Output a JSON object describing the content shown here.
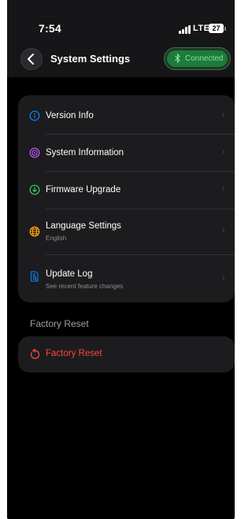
{
  "status_bar": {
    "time": "7:54",
    "network": "LTE",
    "battery": "27"
  },
  "header": {
    "title": "System Settings",
    "connection_status": "Connected",
    "connection_icon": "bluetooth-icon"
  },
  "settings": {
    "items": [
      {
        "label": "Version Info",
        "subtitle": "",
        "icon": "info-icon",
        "icon_color": "#0a84ff"
      },
      {
        "label": "System Information",
        "subtitle": "",
        "icon": "target-icon",
        "icon_color": "#bf5af2"
      },
      {
        "label": "Firmware Upgrade",
        "subtitle": "",
        "icon": "download-icon",
        "icon_color": "#30d158"
      },
      {
        "label": "Language Settings",
        "subtitle": "English",
        "icon": "globe-icon",
        "icon_color": "#ff9f0a"
      },
      {
        "label": "Update Log",
        "subtitle": "See recent feature changes",
        "icon": "document-search-icon",
        "icon_color": "#0a84ff"
      }
    ]
  },
  "factory_reset": {
    "section_title": "Factory Reset",
    "button_label": "Factory Reset",
    "icon": "reset-icon",
    "color": "#ff453a"
  },
  "colors": {
    "background": "#000000",
    "card": "#1c1c1e",
    "connected_green": "#1f7a3c"
  }
}
